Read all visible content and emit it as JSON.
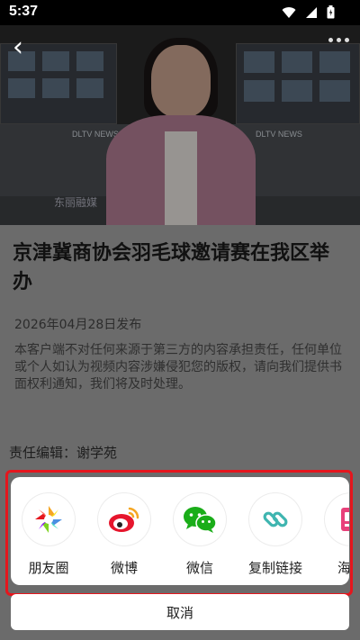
{
  "status_bar": {
    "time": "5:37",
    "icons": [
      "wifi-icon",
      "signal-icon",
      "battery-icon"
    ]
  },
  "video": {
    "channel_label_left": "DLTV NEWS",
    "channel_label_right": "DLTV NEWS",
    "watermark": "东丽融媒"
  },
  "article": {
    "title": "京津冀商协会羽毛球邀请赛在我区举办",
    "date": "2026年04月28日发布",
    "disclaimer": "本客户端不对任何来源于第三方的内容承担责任，任何单位或个人如认为视频内容涉嫌侵犯您的版权，请向我们提供书面权利通知，我们将及时处理。",
    "editor": "责任编辑：谢学苑"
  },
  "share_sheet": {
    "items": [
      {
        "label": "朋友圈",
        "icon": "moments-icon"
      },
      {
        "label": "微博",
        "icon": "weibo-icon"
      },
      {
        "label": "微信",
        "icon": "wechat-icon"
      },
      {
        "label": "复制链接",
        "icon": "link-icon"
      },
      {
        "label": "海报",
        "icon": "poster-icon"
      }
    ],
    "cancel_label": "取消"
  },
  "colors": {
    "highlight_border": "#e5161d",
    "wechat_green": "#1aad19",
    "weibo_red": "#e6162d",
    "link_teal": "#3fb5b0",
    "poster_pink": "#e8407a"
  }
}
